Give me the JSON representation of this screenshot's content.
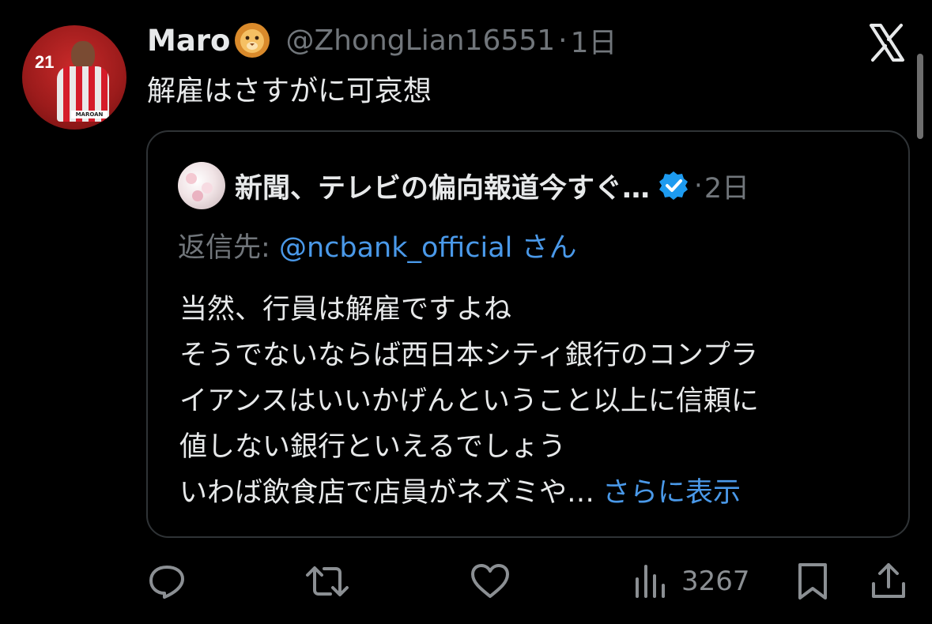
{
  "tweet": {
    "display_name": "Maro",
    "name_emoji": "lion-emoji",
    "handle": "@ZhongLian16551",
    "separator": "·",
    "time": "1日",
    "text": "解雇はさすがに可哀想",
    "avatar": {
      "number": "21",
      "name_strip": "MAROAN"
    }
  },
  "quoted": {
    "display_name": "新聞、テレビの偏向報道今すぐ…",
    "verified": true,
    "separator": "·",
    "time": "2日",
    "reply_label": "返信先:",
    "reply_handle": "@ncbank_official",
    "reply_suffix": "さん",
    "lines": [
      "当然、行員は解雇ですよね",
      "そうでないならば西日本シティ銀行のコンプラ",
      "イアンスはいいかげんということ以上に信頼に",
      "値しない銀行といえるでしょう",
      "いわば飲食店で店員がネズミや…"
    ],
    "show_more": "さらに表示"
  },
  "actions": {
    "reply_icon": "reply-icon",
    "retweet_icon": "retweet-icon",
    "like_icon": "like-icon",
    "views_icon": "views-icon",
    "view_count": "3267",
    "bookmark_icon": "bookmark-icon",
    "share_icon": "share-icon"
  },
  "colors": {
    "background": "#000000",
    "text": "#e7e9ea",
    "muted": "#71767b",
    "link": "#4a99e9",
    "border": "#2f3336",
    "verified": "#1d9bf0"
  }
}
